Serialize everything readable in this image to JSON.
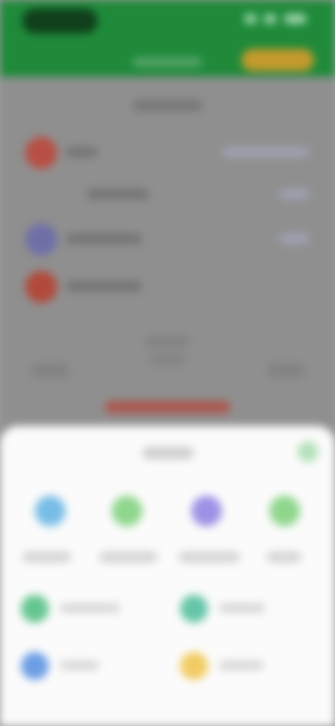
{
  "screen": "blurred-app-with-bottom-sheet",
  "colors": {
    "topbar": "#1f8a3a",
    "cta": "#c49a2c",
    "sheet_bg": "#fbfbfb",
    "dim_overlay": "#8f8f8f",
    "accent_red": "#b14a3f"
  },
  "topbar": {
    "left_pill_icon": "app-logo-icon",
    "status_icons": [
      "signal-icon",
      "wifi-icon",
      "battery-icon"
    ],
    "cta_label": "",
    "subtitle": ""
  },
  "background_list": {
    "title": "",
    "rows": [
      {
        "avatar_color": "#b84f45",
        "label": "",
        "right": ""
      },
      {
        "avatar_color": "#8f8f8f",
        "label": "",
        "right": ""
      },
      {
        "avatar_color": "#6f6fa8",
        "label": "",
        "right": ""
      },
      {
        "avatar_color": "#b24a3c",
        "label": "",
        "right": ""
      }
    ]
  },
  "bottom_sheet": {
    "title": "",
    "close_icon": "close-icon",
    "grid": [
      {
        "icon": "share-icon",
        "color": "#78bde6",
        "label": ""
      },
      {
        "icon": "chat-icon",
        "color": "#8fd68d",
        "label": ""
      },
      {
        "icon": "profile-icon",
        "color": "#9c91e6",
        "label": ""
      },
      {
        "icon": "star-icon",
        "color": "#8fd68d",
        "label": ""
      }
    ],
    "list": [
      {
        "icon": "add-icon",
        "color": "#65c68f",
        "label": ""
      },
      {
        "icon": "settings-icon",
        "color": "#65c6a7",
        "label": ""
      },
      {
        "icon": "info-icon",
        "color": "#6c9ee4",
        "label": ""
      },
      {
        "icon": "notification-icon",
        "color": "#f2cc63",
        "label": ""
      }
    ]
  }
}
